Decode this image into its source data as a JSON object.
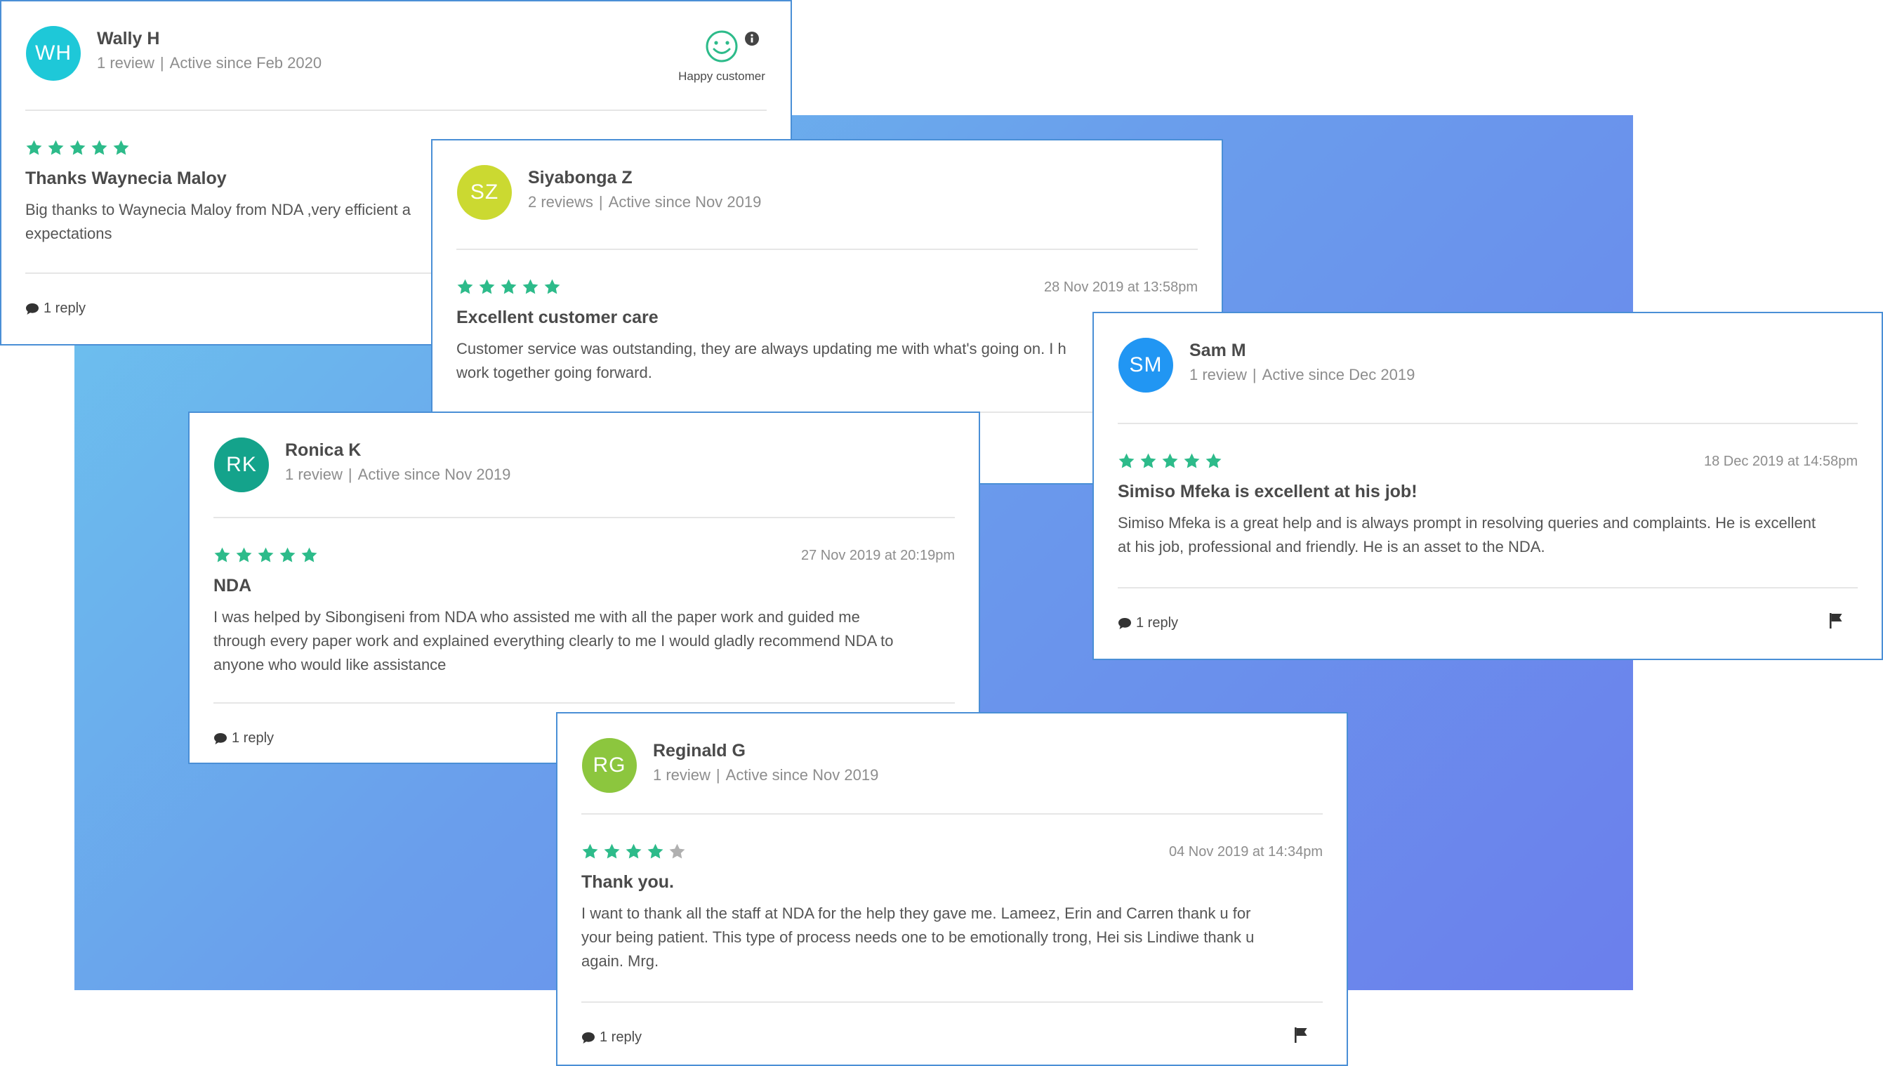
{
  "colors": {
    "accent_green": "#2dbb8a",
    "star_empty": "#b0b0b0",
    "card_border": "#4a8fd6",
    "background_gradient": [
      "#6cc6ee",
      "#6b7fec"
    ]
  },
  "reviews": [
    {
      "initials": "WH",
      "avatar_color": "#1ec8d8",
      "name": "Wally H",
      "review_count": "1 review",
      "active_since": "Active since Feb 2020",
      "badge_label": "Happy customer",
      "badge_icon": "smiley-icon",
      "info_icon": "info-icon",
      "rating": 5,
      "date": "",
      "title": "Thanks Waynecia Maloy",
      "body": "Big thanks to Waynecia Maloy from NDA ,very efficient a",
      "body_line2": "expectations",
      "replies": "1 reply"
    },
    {
      "initials": "SZ",
      "avatar_color": "#cbd931",
      "name": "Siyabonga Z",
      "review_count": "2 reviews",
      "active_since": "Active since Nov 2019",
      "rating": 5,
      "date": "28 Nov 2019 at 13:58pm",
      "title": "Excellent customer care",
      "body": "Customer service was outstanding, they are always updating me with what's going on. I h",
      "body_line2": "work together going forward."
    },
    {
      "initials": "SM",
      "avatar_color": "#2196f3",
      "name": "Sam M",
      "review_count": "1 review",
      "active_since": "Active since Dec 2019",
      "rating": 5,
      "date": "18 Dec 2019 at 14:58pm",
      "title": "Simiso Mfeka is excellent at his job!",
      "body": "Simiso Mfeka is a great help and is always prompt in resolving queries and complaints. He is excellent",
      "body_line2": "at his job, professional and friendly. He is an asset to the NDA.",
      "replies": "1 reply",
      "flag_icon": "flag-icon"
    },
    {
      "initials": "RK",
      "avatar_color": "#14a38b",
      "name": "Ronica K",
      "review_count": "1 review",
      "active_since": "Active since Nov 2019",
      "rating": 5,
      "date": "27 Nov 2019 at 20:19pm",
      "title": "NDA",
      "body": "I was helped by Sibongiseni from NDA who assisted me with all the paper work and guided me",
      "body_line2": "through every paper work and explained everything clearly to me I would gladly recommend NDA to",
      "body_line3": "anyone who would like assistance",
      "replies": "1 reply"
    },
    {
      "initials": "RG",
      "avatar_color": "#8cc63e",
      "name": "Reginald G",
      "review_count": "1 review",
      "active_since": "Active since Nov 2019",
      "rating": 4,
      "date": "04 Nov 2019 at 14:34pm",
      "title": "Thank you.",
      "body": "I want to thank all the staff at NDA for the help they gave me. Lameez, Erin and Carren thank u for",
      "body_line2": "your being patient. This type of process needs one to be emotionally trong, Hei sis Lindiwe thank u",
      "body_line3": "again. Mrg.",
      "replies": "1 reply",
      "flag_icon": "flag-icon"
    }
  ]
}
